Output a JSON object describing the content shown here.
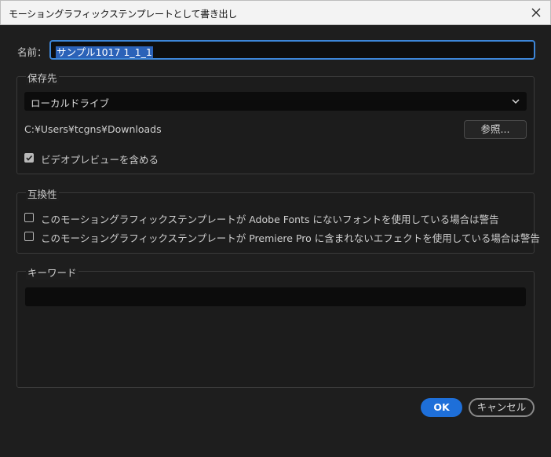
{
  "window": {
    "title": "モーショングラフィックステンプレートとして書き出し",
    "close_icon": "close-icon"
  },
  "name": {
    "label": "名前：",
    "value": "サンプル1017 1_1_1"
  },
  "destination": {
    "legend": "保存先",
    "selected": "ローカルドライブ",
    "path": "C:¥Users¥tcgns¥Downloads",
    "browse_label": "参照...",
    "include_preview_label": "ビデオプレビューを含める",
    "include_preview_checked": true
  },
  "compatibility": {
    "legend": "互換性",
    "options": [
      {
        "label": "このモーショングラフィックステンプレートが Adobe Fonts にないフォントを使用している場合は警告",
        "checked": false
      },
      {
        "label": "このモーショングラフィックステンプレートが Premiere Pro に含まれないエフェクトを使用している場合は警告",
        "checked": false
      }
    ]
  },
  "keywords": {
    "legend": "キーワード",
    "value": ""
  },
  "footer": {
    "ok_label": "OK",
    "cancel_label": "キャンセル"
  },
  "colors": {
    "accent": "#1e6fd9",
    "background": "#1e1e1e",
    "titlebar": "#f3f3f3"
  }
}
